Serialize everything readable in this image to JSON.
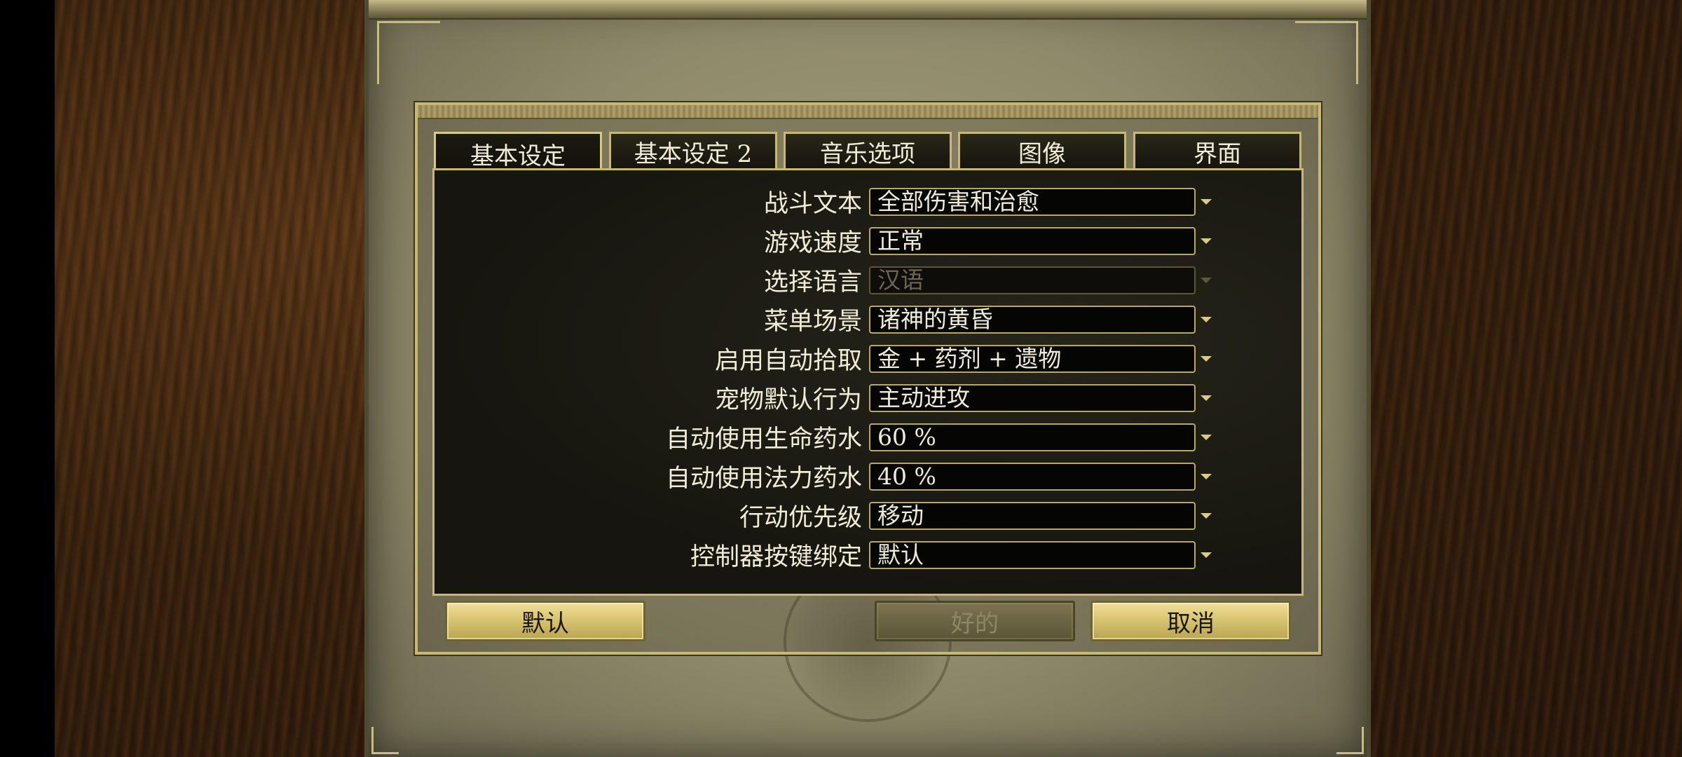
{
  "tabs": [
    {
      "label": "基本设定",
      "active": true
    },
    {
      "label": "基本设定 2",
      "active": false
    },
    {
      "label": "音乐选项",
      "active": false
    },
    {
      "label": "图像",
      "active": false
    },
    {
      "label": "界面",
      "active": false
    }
  ],
  "settings": [
    {
      "label": "战斗文本",
      "value": "全部伤害和治愈",
      "enabled": true
    },
    {
      "label": "游戏速度",
      "value": "正常",
      "enabled": true
    },
    {
      "label": "选择语言",
      "value": "汉语",
      "enabled": false
    },
    {
      "label": "菜单场景",
      "value": "诸神的黄昏",
      "enabled": true
    },
    {
      "label": "启用自动拾取",
      "value": "金 + 药剂 + 遗物",
      "enabled": true
    },
    {
      "label": "宠物默认行为",
      "value": "主动进攻",
      "enabled": true
    },
    {
      "label": "自动使用生命药水",
      "value": "60 %",
      "enabled": true
    },
    {
      "label": "自动使用法力药水",
      "value": "40 %",
      "enabled": true
    },
    {
      "label": "行动优先级",
      "value": "移动",
      "enabled": true
    },
    {
      "label": "控制器按键绑定",
      "value": "默认",
      "enabled": true
    }
  ],
  "buttons": {
    "default_label": "默认",
    "ok_label": "好的",
    "ok_enabled": false,
    "cancel_label": "取消"
  },
  "colors": {
    "accent_gold": "#c9b872",
    "text": "#f1ecd8",
    "panel_dark": "#16150f"
  }
}
